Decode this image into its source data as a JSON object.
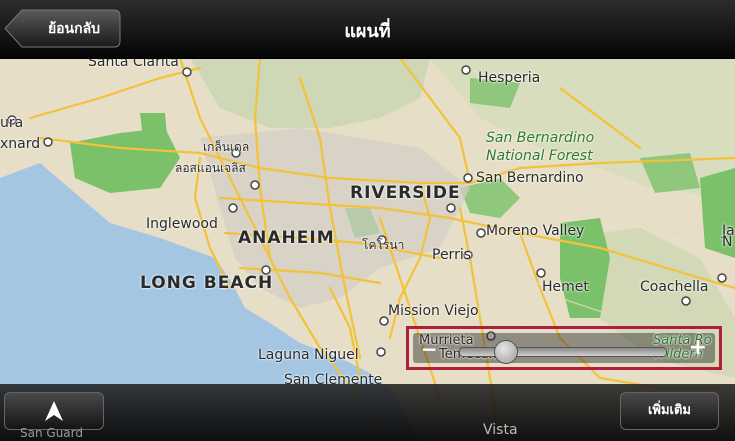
{
  "app": {
    "title": "แผนที่",
    "back_label": "ย้อนกลับ"
  },
  "map": {
    "labels": {
      "santa_clarita": "Santa Clarita",
      "hesperia": "Hesperia",
      "oxnard": "xnard",
      "ura": "ura",
      "glendale": "เกล็นเดล",
      "los_angeles": "ลอสแอนเจลิส",
      "inglewood": "Inglewood",
      "anaheim": "ANAHEIM",
      "riverside": "RIVERSIDE",
      "corona": "โคโรนา",
      "perris": "Perris",
      "long_beach": "LONG BEACH",
      "san_bernardino": "San Bernardino",
      "sb_forest_1": "San Bernardino",
      "sb_forest_2": "National Forest",
      "moreno_valley": "Moreno Valley",
      "hemet": "Hemet",
      "coachella": "Coachella",
      "mission_viejo": "Mission Viejo",
      "murrieta": "Murrieta",
      "temecula": "Temecula",
      "laguna_niguel": "Laguna Niguel",
      "san_clemente": "San Clemente",
      "santa_rosa_1": "Santa Ro",
      "santa_rosa_2": "Wildern",
      "vista": "Vista",
      "san_guard": "San Guard",
      "ja": "Ja",
      "n": "N"
    }
  },
  "zoom": {
    "minus": "−",
    "plus": "+",
    "level_fraction": 0.22
  },
  "bottom": {
    "more_label": "เพิ่มเติม"
  },
  "colors": {
    "land": "#e8e0c8",
    "water": "#a4c6e2",
    "park": "#7bc16a",
    "road": "#f2c23a",
    "highlight": "#b01e3e"
  }
}
